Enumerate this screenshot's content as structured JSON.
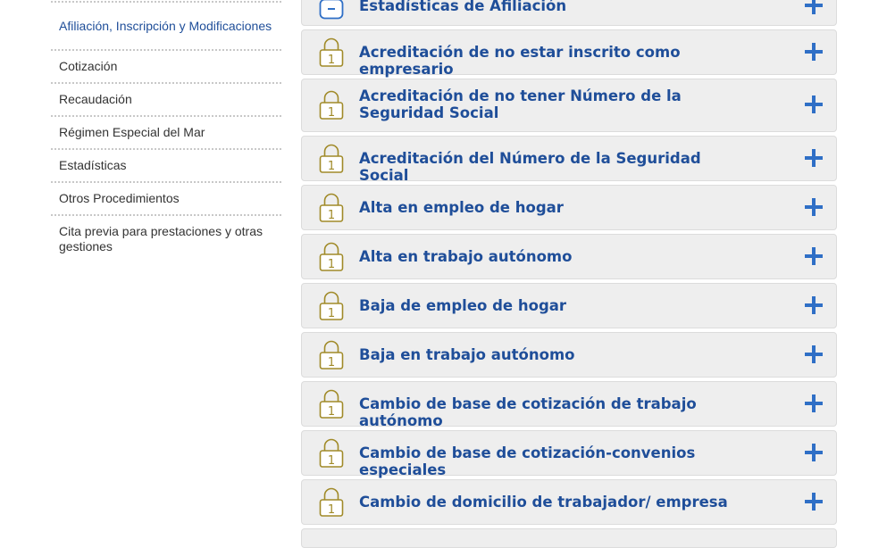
{
  "sidebar": {
    "items": [
      {
        "label": "Afiliación, Inscripción y Modificaciones",
        "active": true
      },
      {
        "label": "Cotización"
      },
      {
        "label": "Recaudación"
      },
      {
        "label": "Régimen Especial del Mar"
      },
      {
        "label": "Estadísticas"
      },
      {
        "label": "Otros Procedimientos"
      },
      {
        "label": "Cita previa para prestaciones y otras gestiones"
      }
    ]
  },
  "procedures": {
    "items": [
      {
        "title": "Estadísticas de Afiliación",
        "icon": "minus-badge-icon"
      },
      {
        "title": "Acreditación de no estar inscrito como empresario",
        "icon": "padlock-level-1-icon",
        "level": "1"
      },
      {
        "title": "Acreditación de no tener Número de la Seguridad Social",
        "icon": "padlock-level-1-icon",
        "level": "1"
      },
      {
        "title": "Acreditación del Número de la Seguridad Social",
        "icon": "padlock-level-1-icon",
        "level": "1"
      },
      {
        "title": "Alta en empleo de hogar",
        "icon": "padlock-level-1-icon",
        "level": "1"
      },
      {
        "title": "Alta en trabajo autónomo",
        "icon": "padlock-level-1-icon",
        "level": "1"
      },
      {
        "title": "Baja de empleo de hogar",
        "icon": "padlock-level-1-icon",
        "level": "1"
      },
      {
        "title": "Baja en trabajo autónomo",
        "icon": "padlock-level-1-icon",
        "level": "1"
      },
      {
        "title": "Cambio de base de cotización de trabajo autónomo",
        "icon": "padlock-level-1-icon",
        "level": "1"
      },
      {
        "title": "Cambio de base de cotización-convenios especiales",
        "icon": "padlock-level-1-icon",
        "level": "1"
      },
      {
        "title": "Cambio de domicilio de trabajador/ empresa",
        "icon": "padlock-level-1-icon",
        "level": "1"
      }
    ]
  },
  "colors": {
    "accent_blue": "#1f4e99",
    "plus_blue": "#2f6fc6",
    "lock_gold": "#a08a28",
    "row_bg": "#eeeeee"
  }
}
